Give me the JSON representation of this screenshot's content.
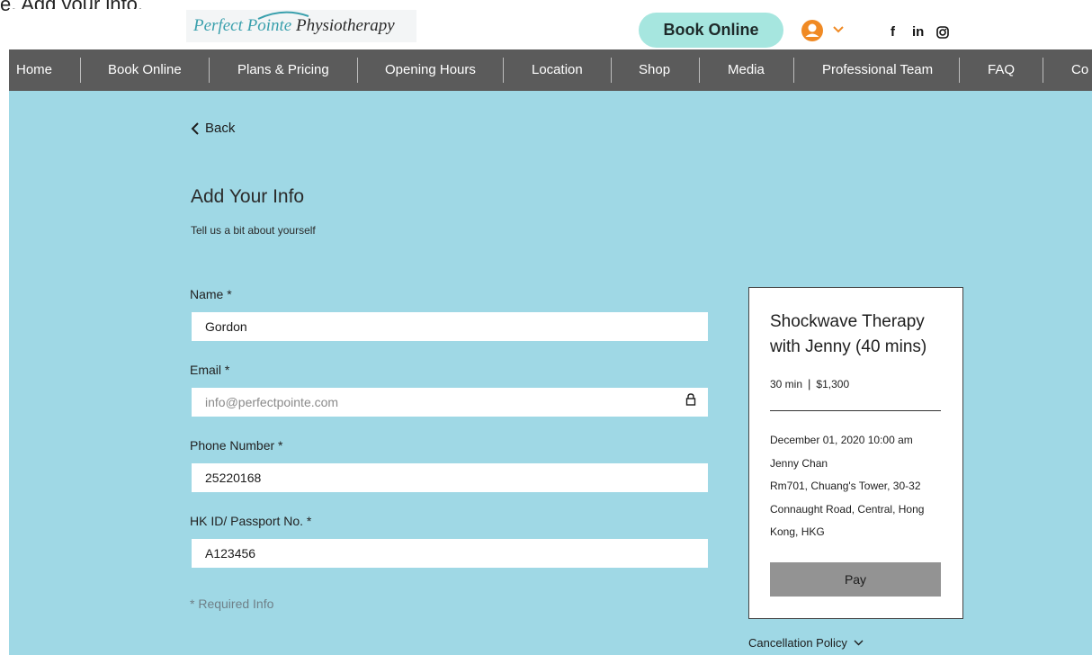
{
  "page": {
    "title_fragment": "e. Add your info."
  },
  "header": {
    "logo": {
      "part1": "Perfect Pointe",
      "part2": "Physiotherapy"
    },
    "book_button": "Book Online",
    "social": {
      "facebook": "f",
      "linkedin": "in",
      "instagram_icon": "instagram-icon"
    },
    "user_icon": "user-avatar-icon"
  },
  "nav": {
    "items": [
      "Home",
      "Book Online",
      "Plans & Pricing",
      "Opening Hours",
      "Location",
      "Shop",
      "Media",
      "Professional Team",
      "FAQ",
      "Co"
    ]
  },
  "form": {
    "back_label": "Back",
    "title": "Add Your Info",
    "subtitle": "Tell us a bit about yourself",
    "fields": [
      {
        "label": "Name *",
        "value": "Gordon"
      },
      {
        "label": "Email *",
        "value": "info@perfectpointe.com"
      },
      {
        "label": "Phone Number *",
        "value": "25220168"
      },
      {
        "label": "HK ID/ Passport No. *",
        "value": "A123456"
      }
    ],
    "required_note": "* Required Info"
  },
  "summary": {
    "service_title": "Shockwave Therapy with Jenny (40 mins)",
    "duration": "30 min",
    "price": "$1,300",
    "datetime": "December 01, 2020 10:00 am",
    "staff": "Jenny Chan",
    "address": "Rm701, Chuang's Tower, 30-32 Connaught Road, Central, Hong Kong, HKG",
    "pay_button": "Pay"
  },
  "cancellation_policy": "Cancellation Policy",
  "colors": {
    "nav_bg": "#5b5b5b",
    "content_bg": "#9fd8e5",
    "book_button_bg": "#a6e6df",
    "user_icon": "#f08a24",
    "pay_button_bg": "#939393"
  }
}
